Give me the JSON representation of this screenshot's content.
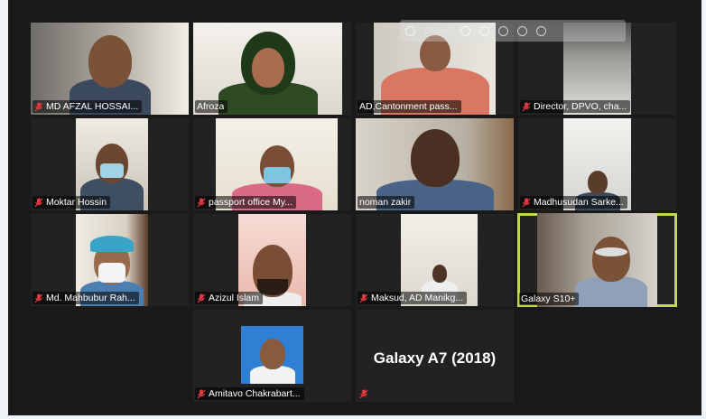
{
  "participants": [
    {
      "name": "MD AFZAL HOSSAI...",
      "muted": true
    },
    {
      "name": "Afroza",
      "muted": false
    },
    {
      "name": "AD,Cantonment pass...",
      "muted": false
    },
    {
      "name": "Director, DPVO, cha...",
      "muted": true
    },
    {
      "name": "Moktar Hossin",
      "muted": true
    },
    {
      "name": "passport office My...",
      "muted": true
    },
    {
      "name": "noman zakir",
      "muted": false
    },
    {
      "name": "Madhusudan Sarke...",
      "muted": true
    },
    {
      "name": "Md. Mahbubur Rah...",
      "muted": true
    },
    {
      "name": "Azizul Islam",
      "muted": true
    },
    {
      "name": "Maksud, AD Manikg...",
      "muted": true
    },
    {
      "name": "Galaxy S10+",
      "muted": false
    },
    {
      "name": "Amitavo Chakrabart...",
      "muted": true
    },
    {
      "name": "",
      "muted": true,
      "display_text": "Galaxy A7 (2018)"
    }
  ],
  "overlay_bar": {
    "language": "English"
  },
  "colors": {
    "active_speaker_border": "#c6d84a",
    "muted_icon": "#e0393e"
  }
}
